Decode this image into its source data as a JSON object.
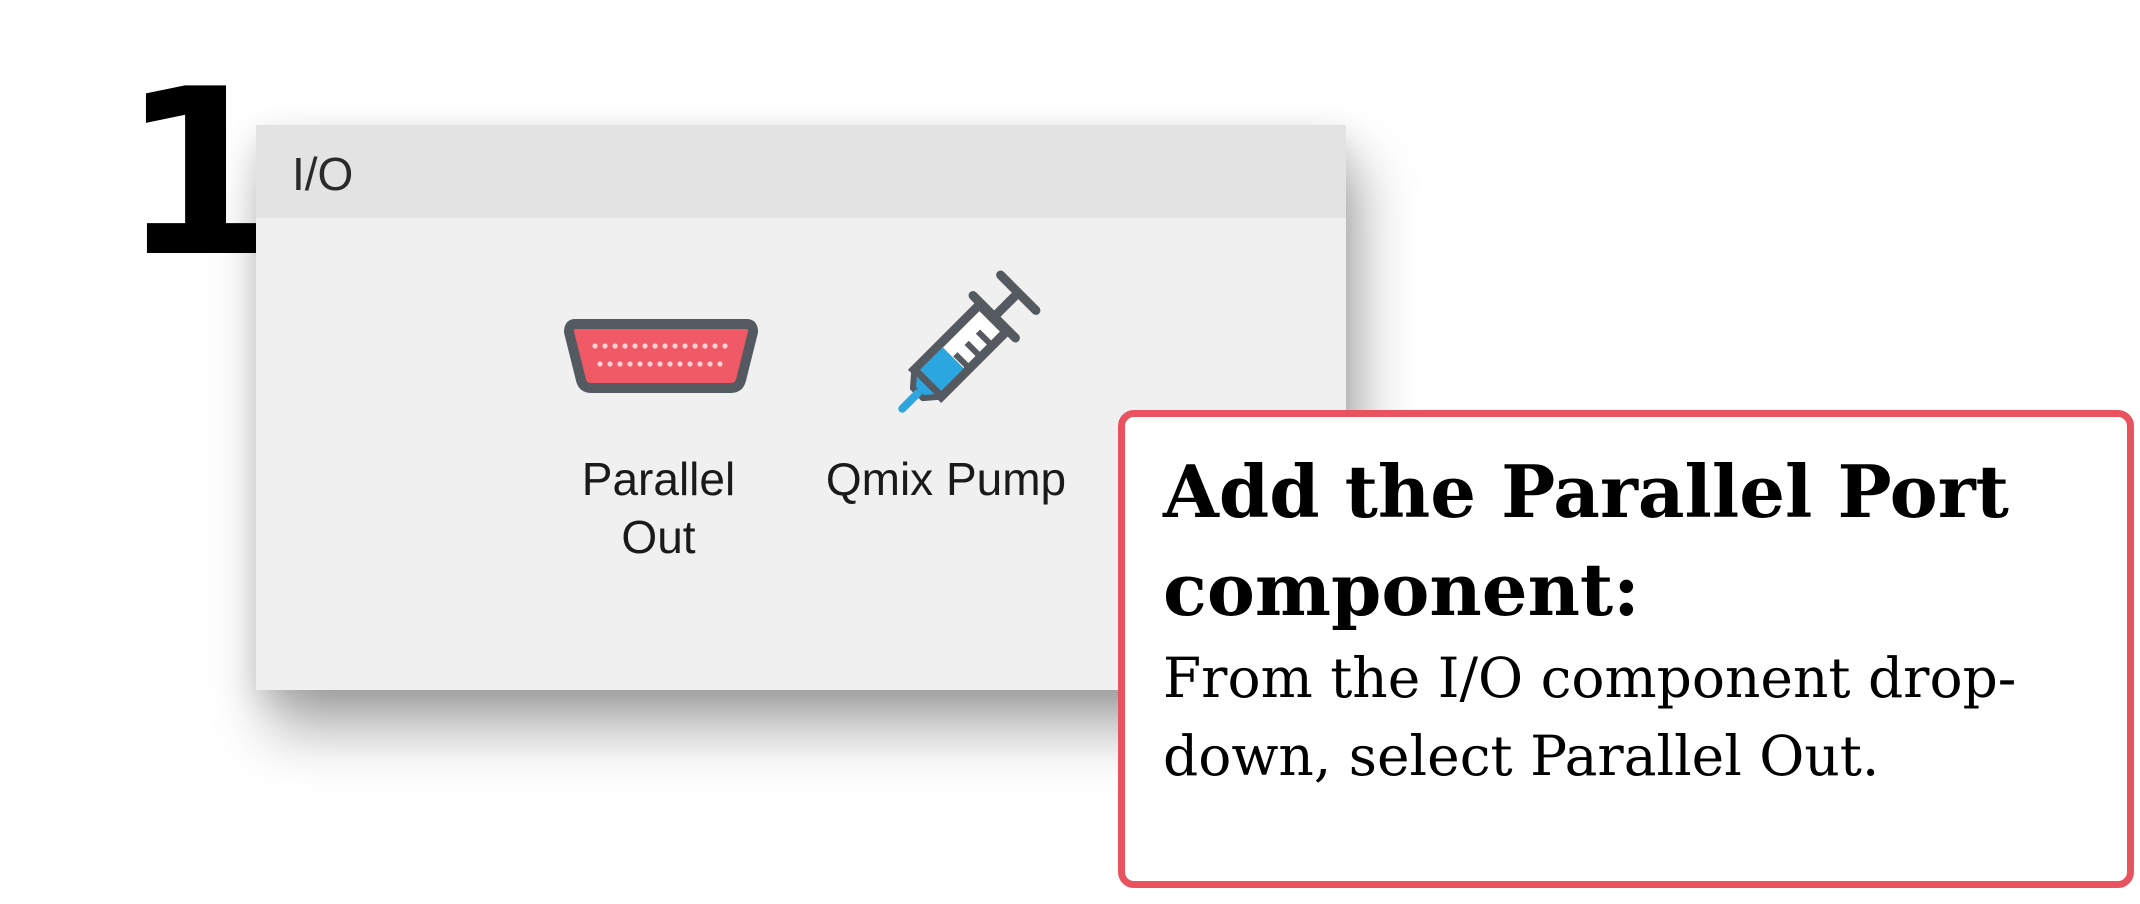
{
  "step": {
    "number": "1"
  },
  "panel": {
    "title": "I/O",
    "components": [
      {
        "label": "Parallel\nOut",
        "icon": "parallel-port-icon"
      },
      {
        "label": "Qmix Pump",
        "icon": "syringe-icon"
      }
    ]
  },
  "callout": {
    "heading": "Add the Parallel Port component:",
    "body": "From the I/O component drop-down, select Parallel Out."
  },
  "colors": {
    "accent": "#e8535f",
    "icon_outline": "#555a60",
    "port_fill": "#ef5a66",
    "liquid": "#2ba6de"
  }
}
